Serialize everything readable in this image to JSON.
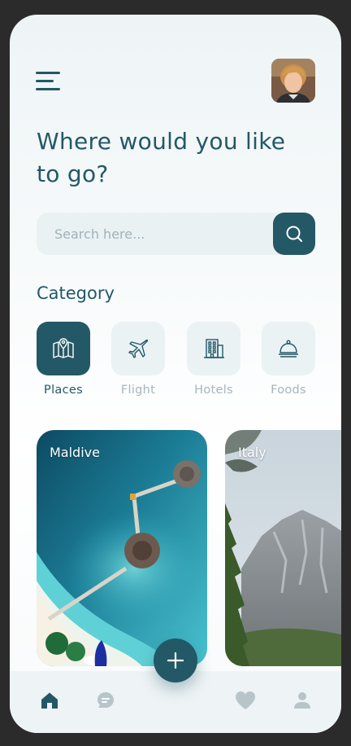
{
  "header": {
    "menu_icon": "hamburger-menu-icon",
    "avatar_icon": "user-avatar"
  },
  "headline": "Where would you like to go?",
  "search": {
    "placeholder": "Search here...",
    "button_icon": "search-icon"
  },
  "category": {
    "title": "Category",
    "items": [
      {
        "label": "Places",
        "icon": "map-icon",
        "active": true
      },
      {
        "label": "Flight",
        "icon": "airplane-icon",
        "active": false
      },
      {
        "label": "Hotels",
        "icon": "hotel-building-icon",
        "active": false
      },
      {
        "label": "Foods",
        "icon": "food-cloche-icon",
        "active": false
      }
    ]
  },
  "destinations": [
    {
      "name": "Maldive"
    },
    {
      "name": "Italy"
    }
  ],
  "bottom_nav": {
    "items": [
      "home-icon",
      "chat-icon",
      "heart-icon",
      "profile-icon"
    ],
    "fab_icon": "plus-icon"
  },
  "colors": {
    "primary": "#235867",
    "tile_bg": "#eaf2f4",
    "muted_text": "#a6b6bb"
  }
}
